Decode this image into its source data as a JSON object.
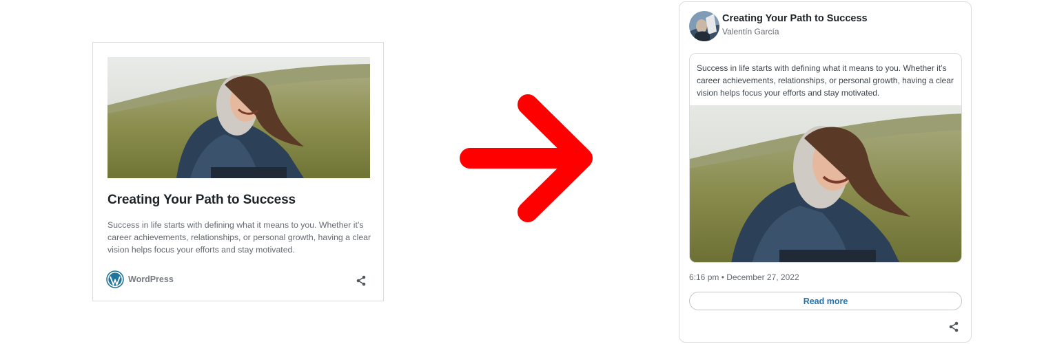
{
  "left_card": {
    "title": "Creating Your Path to Success",
    "excerpt": "Success in life starts with defining what it means to you. Whether it’s career achievements, relationships, or personal growth, having a clear vision helps focus your efforts and stay motivated.",
    "site_name": "WordPress",
    "icons": {
      "site": "wordpress-logo-icon",
      "share": "share-icon"
    }
  },
  "arrow": {
    "color": "#ff0000",
    "icon": "arrow-right-icon"
  },
  "right_card": {
    "title": "Creating Your Path to Success",
    "author": "Valentín García",
    "body": "Success in life starts with defining what it means to you. Whether it’s career achievements, relationships, or personal growth, having a clear vision helps focus your efforts and stay motivated.",
    "timestamp": "6:16 pm • December 27, 2022",
    "read_more_label": "Read more",
    "icons": {
      "share": "share-icon"
    }
  },
  "colors": {
    "accent_link": "#2271b1",
    "wordpress_brand": "#21759b",
    "border": "#dcdcde"
  }
}
